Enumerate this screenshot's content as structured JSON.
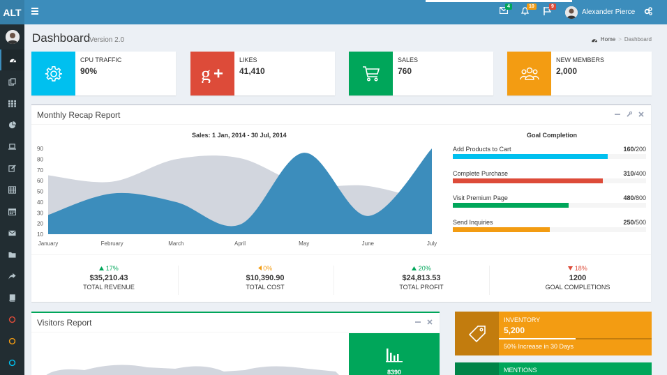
{
  "brand": "ALT",
  "topbar": {
    "mail_badge": "4",
    "notif_badge": "10",
    "flag_badge": "9",
    "user_name": "Alexander Pierce"
  },
  "header": {
    "title": "Dashboard",
    "subtitle": "Version 2.0",
    "breadcrumb": [
      "Home",
      "Dashboard"
    ]
  },
  "info_boxes": [
    {
      "label": "CPU TRAFFIC",
      "value": "90%",
      "color": "#00c0ef",
      "icon": "gear-icon"
    },
    {
      "label": "LIKES",
      "value": "41,410",
      "color": "#dd4b39",
      "icon": "google-plus-icon"
    },
    {
      "label": "SALES",
      "value": "760",
      "color": "#00a65a",
      "icon": "cart-icon"
    },
    {
      "label": "NEW MEMBERS",
      "value": "2,000",
      "color": "#f39c12",
      "icon": "users-icon"
    }
  ],
  "recap": {
    "title": "Monthly Recap Report",
    "chart_title": "Sales: 1 Jan, 2014 - 30 Jul, 2014",
    "goal_title": "Goal Completion",
    "goals": [
      {
        "name": "Add Products to Cart",
        "done": "160",
        "total": "/200",
        "fraction": 0.8,
        "color": "#00c0ef"
      },
      {
        "name": "Complete Purchase",
        "done": "310",
        "total": "/400",
        "fraction": 0.775,
        "color": "#dd4b39"
      },
      {
        "name": "Visit Premium Page",
        "done": "480",
        "total": "/800",
        "fraction": 0.6,
        "color": "#00a65a"
      },
      {
        "name": "Send Inquiries",
        "done": "250",
        "total": "/500",
        "fraction": 0.5,
        "color": "#f39c12"
      }
    ],
    "stats": [
      {
        "pct": "17%",
        "dir": "up",
        "color": "#00a65a",
        "amount": "$35,210.43",
        "caption": "TOTAL REVENUE"
      },
      {
        "pct": "0%",
        "dir": "left",
        "color": "#f39c12",
        "amount": "$10,390.90",
        "caption": "TOTAL COST"
      },
      {
        "pct": "20%",
        "dir": "up",
        "color": "#00a65a",
        "amount": "$24,813.53",
        "caption": "TOTAL PROFIT"
      },
      {
        "pct": "18%",
        "dir": "down",
        "color": "#dd4b39",
        "amount": "1200",
        "caption": "GOAL COMPLETIONS"
      }
    ]
  },
  "chart_data": {
    "type": "area",
    "categories": [
      "January",
      "February",
      "March",
      "April",
      "May",
      "June",
      "July"
    ],
    "yticks": [
      "90",
      "80",
      "70",
      "60",
      "50",
      "40",
      "30",
      "20",
      "10"
    ],
    "ylim": [
      10,
      90
    ],
    "series": [
      {
        "values": [
          65,
          59,
          80,
          81,
          56,
          55,
          40
        ],
        "color": "#d2d6de"
      },
      {
        "values": [
          28,
          48,
          40,
          19,
          86,
          27,
          90
        ],
        "color": "#3c8dbc"
      }
    ],
    "title": "Sales: 1 Jan, 2014 - 30 Jul, 2014",
    "xlabel": "",
    "ylabel": ""
  },
  "visitors": {
    "title": "Visitors Report",
    "count": "8390"
  },
  "inventory": {
    "label": "INVENTORY",
    "value": "5,200",
    "progress": 0.5,
    "description": "50% Increase in 30 Days",
    "color": "#f39c12"
  },
  "mentions": {
    "label": "MENTIONS",
    "color": "#00a65a"
  },
  "sidebar_icons": [
    "dashboard-icon",
    "files-icon",
    "th-icon",
    "pie-chart-icon",
    "laptop-icon",
    "edit-icon",
    "table-icon",
    "calendar-icon",
    "envelope-icon",
    "folder-icon",
    "share-icon",
    "book-icon",
    "circle-red-icon",
    "circle-yellow-icon",
    "circle-aqua-icon"
  ]
}
